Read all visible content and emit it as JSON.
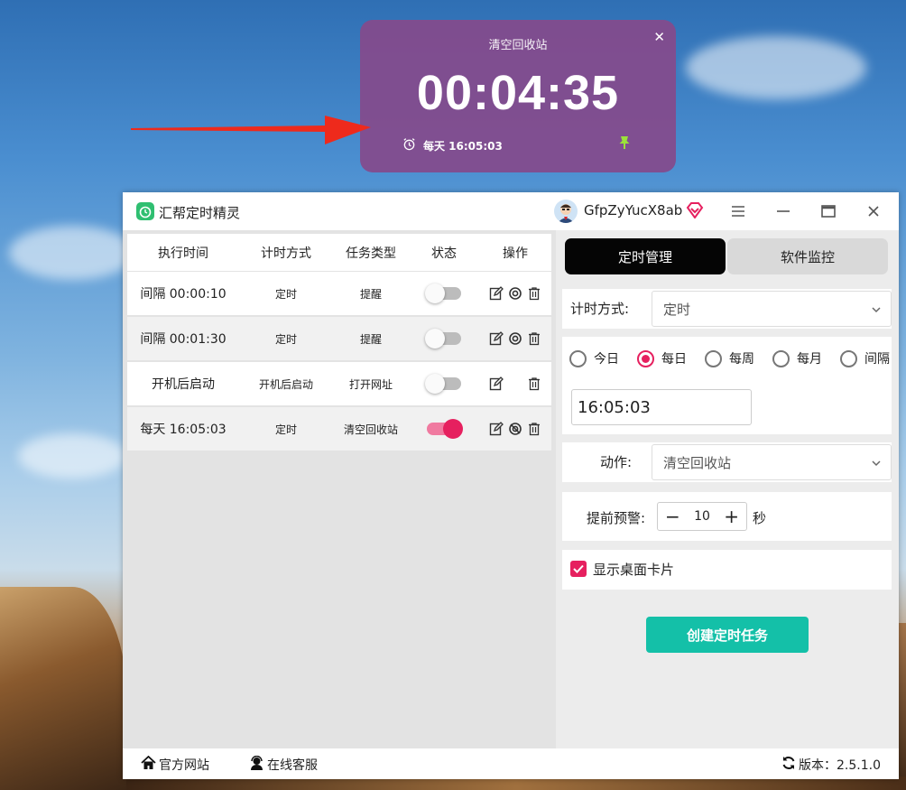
{
  "desk_card": {
    "title": "清空回收站",
    "timer": "00:04:35",
    "schedule": "每天 16:05:03",
    "accent": "#844a8c"
  },
  "window": {
    "app_title": "汇帮定时精灵",
    "username": "GfpZyYucX8ab",
    "menu_icon": "hamburger-icon",
    "minimize_icon": "minimize-icon",
    "maximize_icon": "maximize-icon",
    "close_icon": "close-icon"
  },
  "task_table": {
    "columns": [
      "执行时间",
      "计时方式",
      "任务类型",
      "状态",
      "操作"
    ],
    "rows": [
      {
        "time": "间隔 00:00:10",
        "mode": "定时",
        "type": "提醒",
        "enabled": false
      },
      {
        "time": "间隔 00:01:30",
        "mode": "定时",
        "type": "提醒",
        "enabled": false
      },
      {
        "time": "开机后启动",
        "mode": "开机后启动",
        "type": "打开网址",
        "enabled": false
      },
      {
        "time": "每天 16:05:03",
        "mode": "定时",
        "type": "清空回收站",
        "enabled": true
      }
    ]
  },
  "right_panel": {
    "tabs": [
      "定时管理",
      "软件监控"
    ],
    "timer_mode_label": "计时方式:",
    "timer_mode_value": "定时",
    "frequency_options": [
      "今日",
      "每日",
      "每周",
      "每月",
      "间隔"
    ],
    "frequency_selected": "每日",
    "time_value": "16:05:03",
    "action_label": "动作:",
    "action_value": "清空回收站",
    "warning_label": "提前预警:",
    "warning_value": "10",
    "warning_unit": "秒",
    "show_card_label": "显示桌面卡片",
    "show_card_checked": true,
    "create_button": "创建定时任务"
  },
  "statusbar": {
    "website": "官方网站",
    "support": "在线客服",
    "version": "版本：2.5.1.0"
  },
  "colors": {
    "primary_pink": "#e6205f",
    "create_button": "#14c0a8",
    "arrow_red": "#ee2a1c"
  }
}
